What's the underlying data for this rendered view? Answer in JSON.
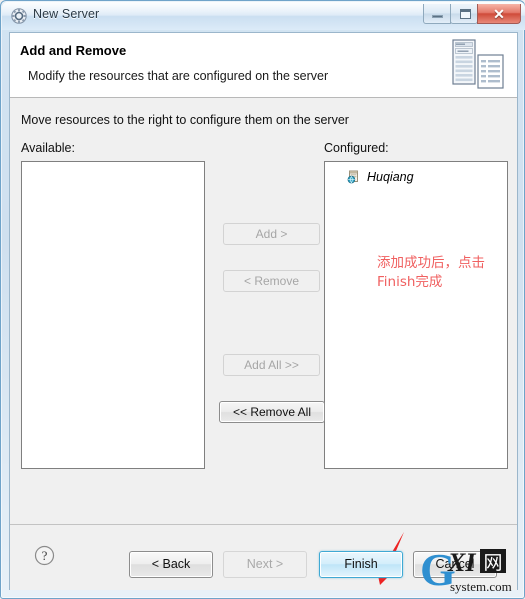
{
  "window": {
    "title": "New Server",
    "icon": "server-wizard-icon",
    "controls": {
      "minimize": "minimize-icon",
      "maximize": "maximize-icon",
      "close": "close-icon",
      "close_glyph": "✕"
    }
  },
  "banner": {
    "title": "Add and Remove",
    "subtitle": "Modify the resources that are configured on the server",
    "icon": "server-tower-document-icon"
  },
  "main": {
    "instruction": "Move resources to the right to configure them on the server",
    "available": {
      "label": "Available:",
      "items": []
    },
    "configured": {
      "label": "Configured:",
      "items": [
        {
          "label": "Huqiang",
          "icon": "web-module-icon"
        }
      ],
      "annotation": "添加成功后，点击\nFinish完成",
      "annotation_color": "#f06060"
    },
    "transfer_buttons": [
      {
        "label": "Add >",
        "state": "disabled",
        "name": "add-button"
      },
      {
        "label": "< Remove",
        "state": "disabled",
        "name": "remove-button"
      },
      {
        "label": "Add All >>",
        "state": "disabled",
        "name": "add-all-button"
      },
      {
        "label": "<< Remove All",
        "state": "enabled",
        "name": "remove-all-button"
      }
    ]
  },
  "footer": {
    "help": "?",
    "buttons": {
      "back": "< Back",
      "next": "Next >",
      "finish": "Finish",
      "cancel": "Cancel"
    }
  },
  "watermark": {
    "primary": "G",
    "middle": "XI",
    "box": "网",
    "subtitle": "system.com"
  },
  "colors": {
    "accent": "#3fa9d4",
    "annotation": "#f06060",
    "arrow": "#ee2222",
    "titlebar_text": "#2b3a46",
    "close_button": "#cf4b3a"
  }
}
